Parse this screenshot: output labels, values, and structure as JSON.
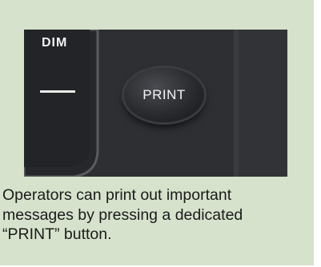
{
  "photo": {
    "dim_label": "DIM",
    "button_label": "PRINT"
  },
  "caption": {
    "lines": [
      "Operators can print out important",
      "messages by pressing a dedicated",
      "“PRINT” button."
    ]
  },
  "colors": {
    "card_background": "#d6e2cc",
    "device_panel": "#2c2d30",
    "caption_text": "#1b1b1b"
  }
}
